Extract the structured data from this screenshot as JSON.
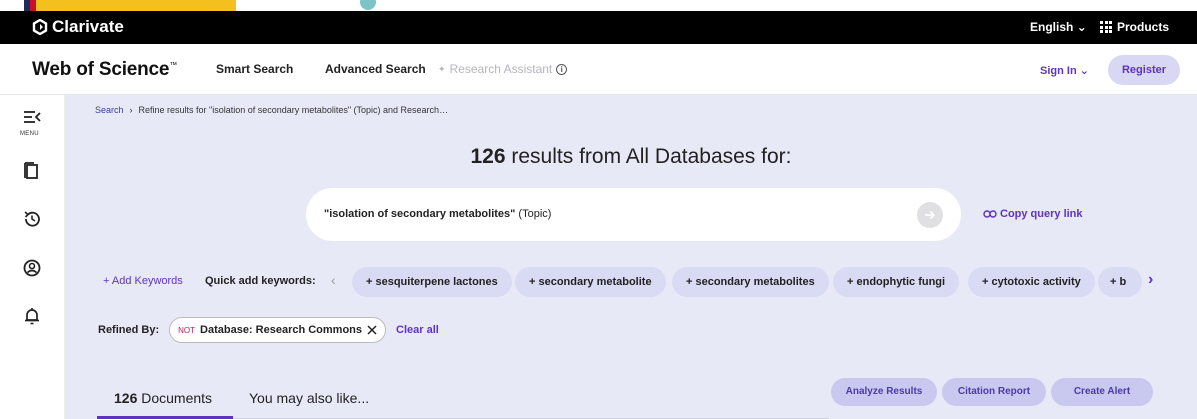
{
  "clarivate": {
    "brand": "Clarivate",
    "language": "English",
    "products": "Products"
  },
  "wos": {
    "logo": "Web of Science",
    "tm": "™",
    "nav": {
      "smart": "Smart Search",
      "advanced": "Advanced Search",
      "research_assistant": "Research Assistant"
    },
    "sign_in": "Sign In",
    "register": "Register"
  },
  "rail": {
    "menu_label": "MENU",
    "icons": [
      "menu-icon",
      "bookmark-icon",
      "history-icon",
      "profile-icon",
      "bell-icon"
    ]
  },
  "breadcrumb": {
    "search": "Search",
    "current": "Refine results for \"isolation of secondary metabolites\" (Topic) and Research…"
  },
  "results": {
    "count": "126",
    "suffix": " results from All Databases for:"
  },
  "query": {
    "term": "\"isolation of secondary metabolites\"",
    "field": " (Topic)",
    "copy_link": "Copy query link"
  },
  "keywords": {
    "add_label": "+ Add Keywords",
    "quick_label": "Quick add keywords:",
    "chips": [
      "+ sesquiterpene lactones",
      "+ secondary metabolite",
      "+ secondary metabolites",
      "+ endophytic fungi",
      "+ cytotoxic activity",
      "+ b"
    ]
  },
  "refined": {
    "label": "Refined By:",
    "not": "NOT",
    "filter": "Database: Research Commons",
    "clear_all": "Clear all"
  },
  "tabs": {
    "docs_count": "126",
    "docs_label": " Documents",
    "also": "You may also like..."
  },
  "actions": {
    "analyze": "Analyze Results",
    "citation": "Citation Report",
    "alert": "Create Alert"
  },
  "colors": {
    "accent": "#5e33bf",
    "main_bg": "#e8e9f7",
    "chip_bg": "#d9daf3",
    "topbar": "#000000"
  }
}
